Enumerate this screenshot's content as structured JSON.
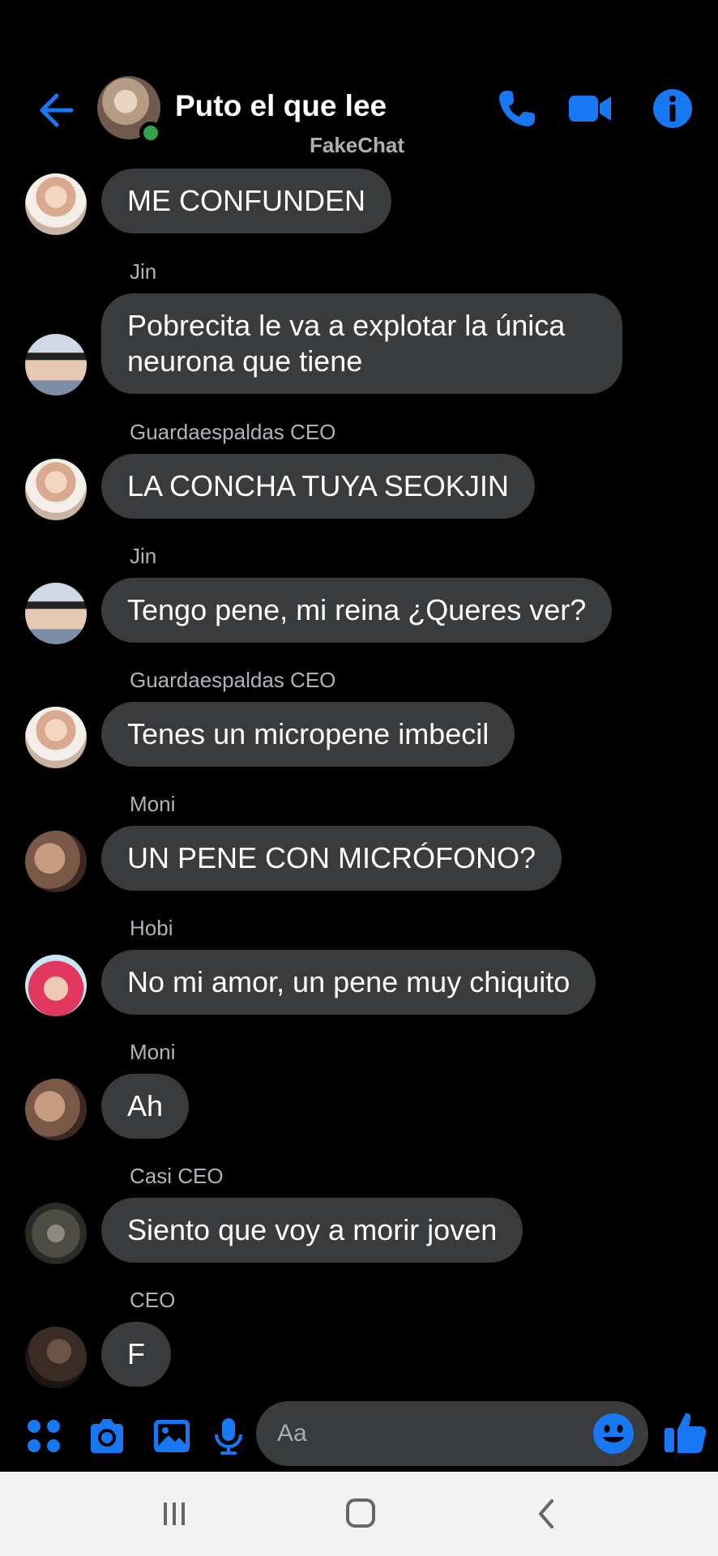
{
  "header": {
    "title": "Puto el que lee",
    "watermark": "FakeChat"
  },
  "colors": {
    "accent": "#1877f2",
    "bubble": "#3a3b3c",
    "online": "#31a24c",
    "background": "#000000",
    "sender_text": "#b0b3b8"
  },
  "messages": [
    {
      "sender": "",
      "avatar": "guard",
      "text": "ME CONFUNDEN"
    },
    {
      "sender": "Jin",
      "avatar": "jin",
      "text": "Pobrecita le va a explotar la única neurona que tiene"
    },
    {
      "sender": "Guardaespaldas CEO",
      "avatar": "guard",
      "text": "LA CONCHA TUYA SEOKJIN"
    },
    {
      "sender": "Jin",
      "avatar": "jin",
      "text": "Tengo pene, mi reina ¿Queres ver?"
    },
    {
      "sender": "Guardaespaldas CEO",
      "avatar": "guard",
      "text": "Tenes un micropene imbecil"
    },
    {
      "sender": "Moni",
      "avatar": "moni",
      "text": "UN PENE CON MICRÓFONO?"
    },
    {
      "sender": "Hobi",
      "avatar": "hobi",
      "text": "No mi amor, un pene muy chiquito"
    },
    {
      "sender": "Moni",
      "avatar": "moni",
      "text": "Ah"
    },
    {
      "sender": "Casi CEO",
      "avatar": "casi",
      "text": "Siento que voy a morir joven"
    },
    {
      "sender": "CEO",
      "avatar": "ceo",
      "text": "F"
    }
  ],
  "composer": {
    "placeholder": "Aa"
  },
  "icons": {
    "back": "arrow-left-icon",
    "call": "phone-icon",
    "video": "video-camera-icon",
    "info": "info-icon",
    "apps": "apps-grid-icon",
    "camera": "camera-icon",
    "gallery": "image-icon",
    "mic": "microphone-icon",
    "emoji": "emoji-icon",
    "like": "thumbs-up-icon"
  }
}
